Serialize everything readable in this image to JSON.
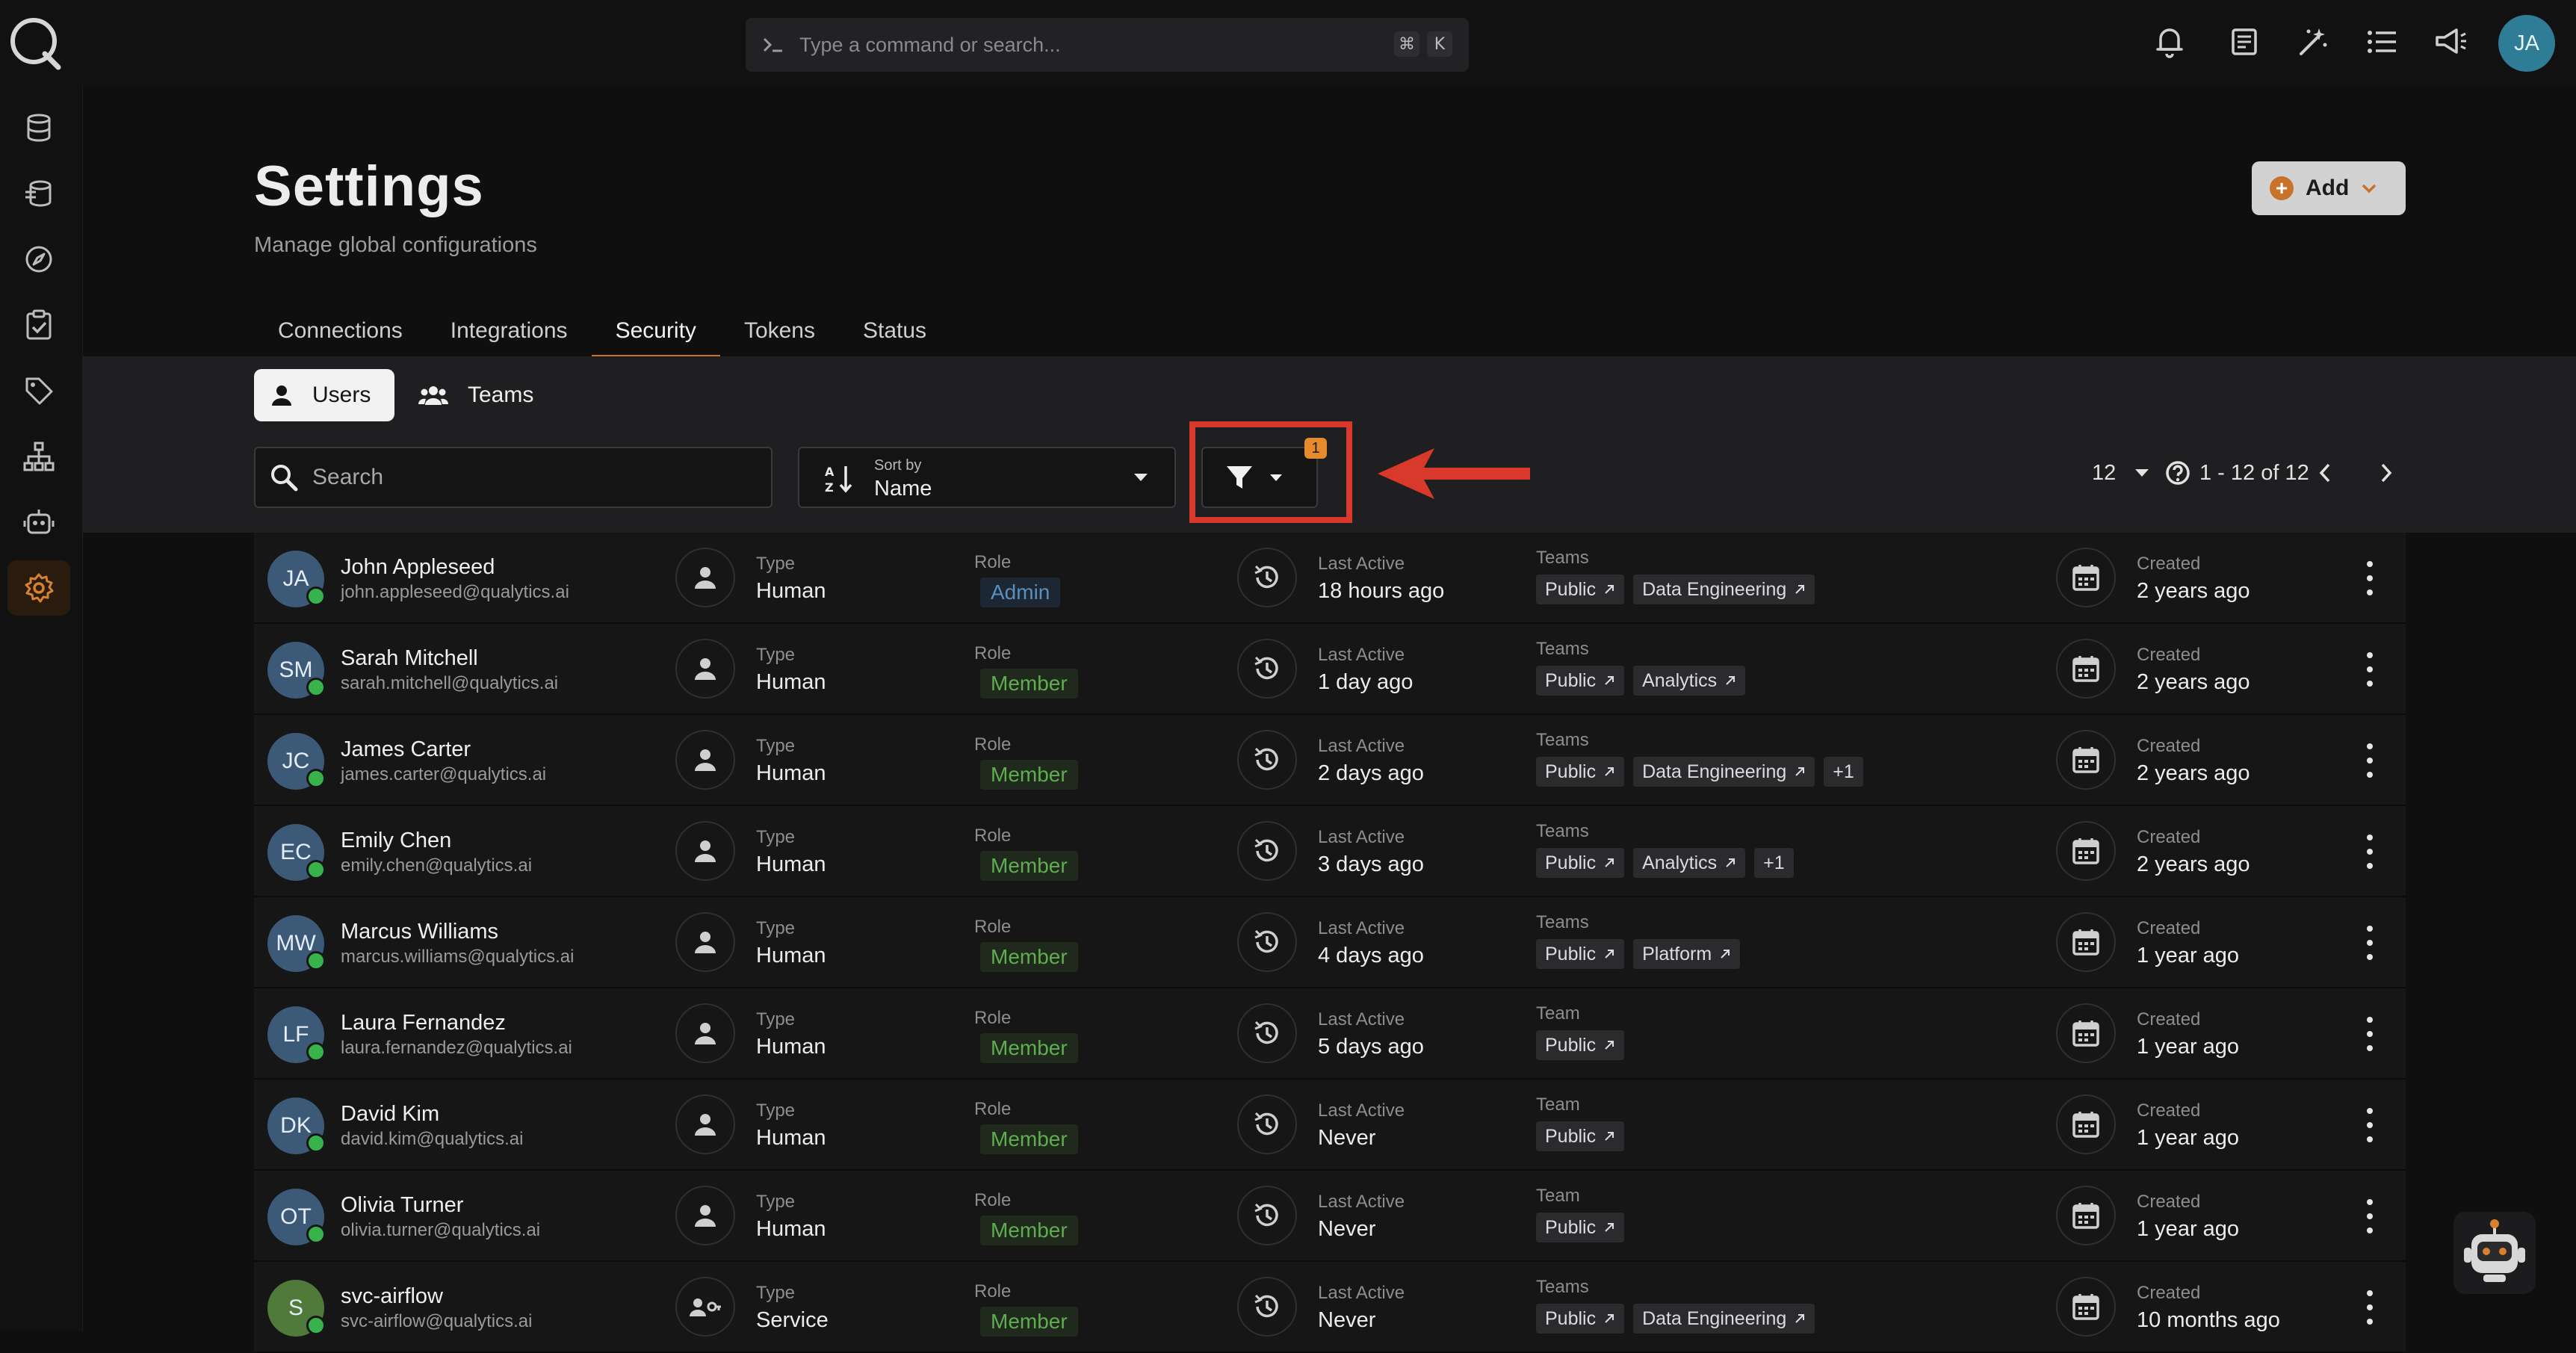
{
  "command_bar": {
    "placeholder": "Type a command or search...",
    "keys": [
      "⌘",
      "K"
    ]
  },
  "user_avatar": "JA",
  "sidebar": {
    "items": [
      {
        "icon": "database-icon"
      },
      {
        "icon": "sources-icon"
      },
      {
        "icon": "compass-icon"
      },
      {
        "icon": "checklist-icon"
      },
      {
        "icon": "tag-icon"
      },
      {
        "icon": "hierarchy-icon"
      },
      {
        "icon": "robot-icon"
      },
      {
        "icon": "gear-icon",
        "active": true
      }
    ]
  },
  "header": {
    "title": "Settings",
    "subtitle": "Manage global configurations",
    "add_label": "Add"
  },
  "tabs": [
    {
      "label": "Connections"
    },
    {
      "label": "Integrations"
    },
    {
      "label": "Security",
      "active": true
    },
    {
      "label": "Tokens"
    },
    {
      "label": "Status"
    }
  ],
  "segments": {
    "users": "Users",
    "teams": "Teams"
  },
  "toolbar": {
    "search_placeholder": "Search",
    "sort_caption": "Sort by",
    "sort_value": "Name",
    "filter_count": "1",
    "page_size": "12",
    "range": "1 - 12 of 12"
  },
  "labels": {
    "type": "Type",
    "role": "Role",
    "last_active": "Last Active",
    "teams": "Teams",
    "team": "Team",
    "created": "Created"
  },
  "users": [
    {
      "initials": "JA",
      "name": "John Appleseed",
      "email": "john.appleseed@qualytics.ai",
      "type": "Human",
      "role": "Admin",
      "last_active": "18 hours ago",
      "teams_label": "Teams",
      "teams": [
        "Public",
        "Data Engineering"
      ],
      "extra": "",
      "created": "2 years ago",
      "avatar_color": "#3c5a78"
    },
    {
      "initials": "SM",
      "name": "Sarah Mitchell",
      "email": "sarah.mitchell@qualytics.ai",
      "type": "Human",
      "role": "Member",
      "last_active": "1 day ago",
      "teams_label": "Teams",
      "teams": [
        "Public",
        "Analytics"
      ],
      "extra": "",
      "created": "2 years ago",
      "avatar_color": "#3c5a78"
    },
    {
      "initials": "JC",
      "name": "James Carter",
      "email": "james.carter@qualytics.ai",
      "type": "Human",
      "role": "Member",
      "last_active": "2 days ago",
      "teams_label": "Teams",
      "teams": [
        "Public",
        "Data Engineering"
      ],
      "extra": "+1",
      "created": "2 years ago",
      "avatar_color": "#3c5a78"
    },
    {
      "initials": "EC",
      "name": "Emily Chen",
      "email": "emily.chen@qualytics.ai",
      "type": "Human",
      "role": "Member",
      "last_active": "3 days ago",
      "teams_label": "Teams",
      "teams": [
        "Public",
        "Analytics"
      ],
      "extra": "+1",
      "created": "2 years ago",
      "avatar_color": "#3c5a78"
    },
    {
      "initials": "MW",
      "name": "Marcus Williams",
      "email": "marcus.williams@qualytics.ai",
      "type": "Human",
      "role": "Member",
      "last_active": "4 days ago",
      "teams_label": "Teams",
      "teams": [
        "Public",
        "Platform"
      ],
      "extra": "",
      "created": "1 year ago",
      "avatar_color": "#3c5a78"
    },
    {
      "initials": "LF",
      "name": "Laura Fernandez",
      "email": "laura.fernandez@qualytics.ai",
      "type": "Human",
      "role": "Member",
      "last_active": "5 days ago",
      "teams_label": "Team",
      "teams": [
        "Public"
      ],
      "extra": "",
      "created": "1 year ago",
      "avatar_color": "#3c5a78"
    },
    {
      "initials": "DK",
      "name": "David Kim",
      "email": "david.kim@qualytics.ai",
      "type": "Human",
      "role": "Member",
      "last_active": "Never",
      "teams_label": "Team",
      "teams": [
        "Public"
      ],
      "extra": "",
      "created": "1 year ago",
      "avatar_color": "#3c5a78"
    },
    {
      "initials": "OT",
      "name": "Olivia Turner",
      "email": "olivia.turner@qualytics.ai",
      "type": "Human",
      "role": "Member",
      "last_active": "Never",
      "teams_label": "Team",
      "teams": [
        "Public"
      ],
      "extra": "",
      "created": "1 year ago",
      "avatar_color": "#3c5a78"
    },
    {
      "initials": "S",
      "name": "svc-airflow",
      "email": "svc-airflow@qualytics.ai",
      "type": "Service",
      "role": "Member",
      "last_active": "Never",
      "teams_label": "Teams",
      "teams": [
        "Public",
        "Data Engineering"
      ],
      "extra": "",
      "created": "10 months ago",
      "avatar_color": "#4f7a3a"
    }
  ],
  "colors": {
    "accent": "#c9722a",
    "highlight": "#d8392b",
    "badge": "#e58a2d",
    "online": "#38b24a"
  }
}
